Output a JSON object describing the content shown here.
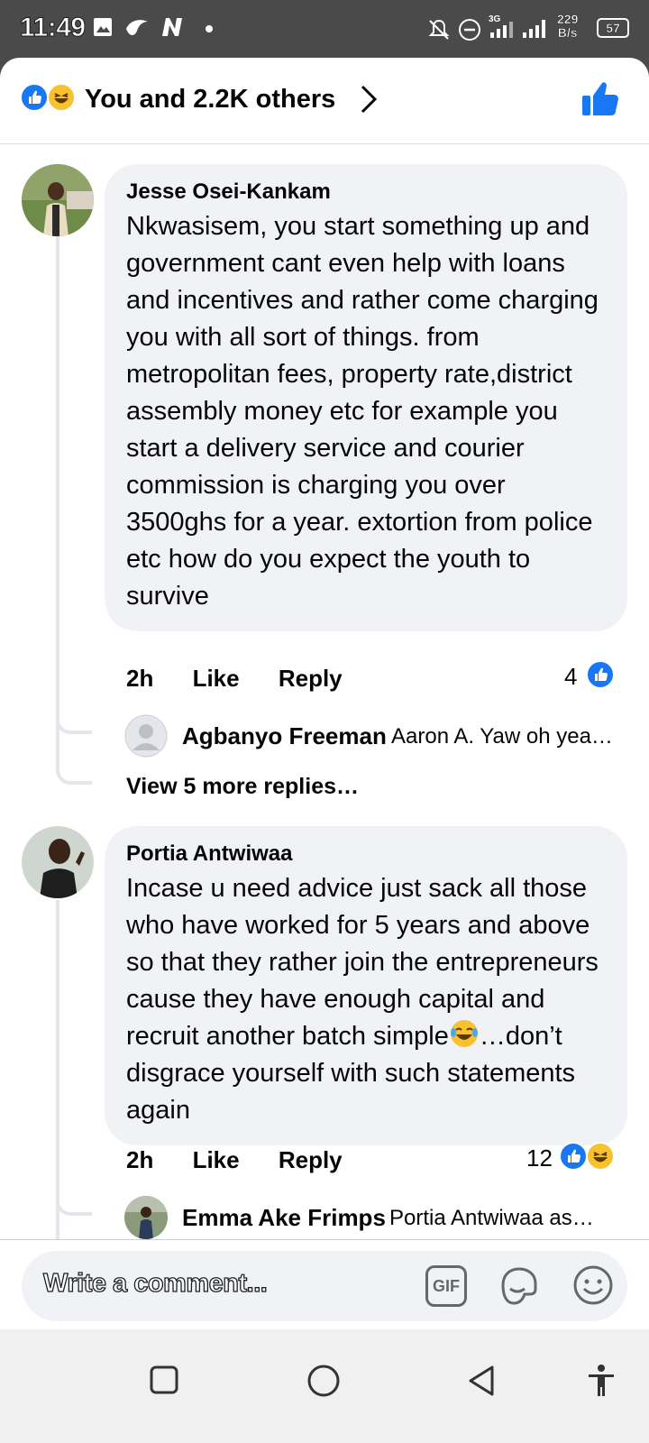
{
  "status_bar": {
    "time": "11:49",
    "network": "3G",
    "speed_value": "229",
    "speed_unit": "B/s",
    "battery": "57"
  },
  "header": {
    "reactions_text": "You and 2.2K others",
    "reaction_icons": [
      "like-icon",
      "haha-icon"
    ]
  },
  "comments": [
    {
      "author": "Jesse Osei-Kankam",
      "text": "Nkwasisem, you start something up and government cant even help with loans and incentives and rather come charging you with all sort of things. from metropolitan fees, property rate,district assembly money etc for example you start a delivery service and courier commission is charging you over 3500ghs for a year. extortion from police etc how do you expect the youth to survive",
      "time": "2h",
      "like_label": "Like",
      "reply_label": "Reply",
      "reaction_count": "4",
      "reply_preview": {
        "author": "Agbanyo Freeman",
        "snippet": "Aaron A. Yaw oh yea…"
      },
      "view_more": "View 5 more replies…"
    },
    {
      "author": "Portia Antwiwaa",
      "text_before_emoji": "Incase u need advice just sack all those who have worked for 5 years and above so that they rather join the entrepreneurs cause they have enough capital and recruit another batch simple",
      "text_after_emoji": "…don’t disgrace yourself with such statements again",
      "time": "2h",
      "like_label": "Like",
      "reply_label": "Reply",
      "reaction_count": "12",
      "reply_preview": {
        "author": "Emma Ake Frimps",
        "snippet": "Portia Antwiwaa as…"
      }
    }
  ],
  "composer": {
    "placeholder": "Write a comment...",
    "gif_label": "GIF"
  },
  "colors": {
    "facebook_blue": "#1877f2",
    "bubble_bg": "#f0f2f5",
    "haha_yellow": "#f7c12f"
  }
}
